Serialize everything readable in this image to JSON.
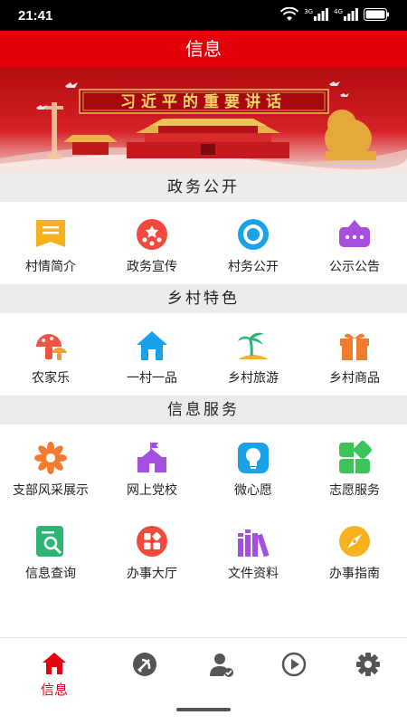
{
  "status_bar": {
    "time": "21:41",
    "signal_labels": [
      "3G",
      "4G"
    ]
  },
  "app_bar": {
    "title": "信息"
  },
  "banner": {
    "headline": "习近平的重要讲话"
  },
  "sections": [
    {
      "title": "政务公开",
      "items": [
        {
          "label": "村情简介",
          "icon": "flag-document-icon"
        },
        {
          "label": "政务宣传",
          "icon": "stars-badge-icon"
        },
        {
          "label": "村务公开",
          "icon": "eye-icon"
        },
        {
          "label": "公示公告",
          "icon": "notice-board-icon"
        }
      ]
    },
    {
      "title": "乡村特色",
      "items": [
        {
          "label": "农家乐",
          "icon": "mushroom-icon"
        },
        {
          "label": "一村一品",
          "icon": "house-icon"
        },
        {
          "label": "乡村旅游",
          "icon": "palm-island-icon"
        },
        {
          "label": "乡村商品",
          "icon": "gift-box-icon"
        }
      ]
    },
    {
      "title": "信息服务",
      "items": [
        {
          "label": "支部风采展示",
          "icon": "flower-icon"
        },
        {
          "label": "网上党校",
          "icon": "school-building-icon"
        },
        {
          "label": "微心愿",
          "icon": "lightbulb-icon"
        },
        {
          "label": "志愿服务",
          "icon": "clover-icon"
        },
        {
          "label": "信息查询",
          "icon": "search-document-icon"
        },
        {
          "label": "办事大厅",
          "icon": "apps-grid-icon"
        },
        {
          "label": "文件资料",
          "icon": "books-icon"
        },
        {
          "label": "办事指南",
          "icon": "compass-icon"
        }
      ]
    }
  ],
  "bottom_nav": [
    {
      "label": "信息",
      "icon": "home-icon",
      "active": true
    },
    {
      "label": "",
      "icon": "party-emblem-icon",
      "active": false
    },
    {
      "label": "",
      "icon": "user-badge-icon",
      "active": false
    },
    {
      "label": "",
      "icon": "play-circle-icon",
      "active": false
    },
    {
      "label": "",
      "icon": "gear-icon",
      "active": false
    }
  ],
  "colors": {
    "app_bar": "#e4000a",
    "active_nav": "#e60012",
    "inactive_nav": "#555555",
    "section_bg": "#ececec"
  }
}
